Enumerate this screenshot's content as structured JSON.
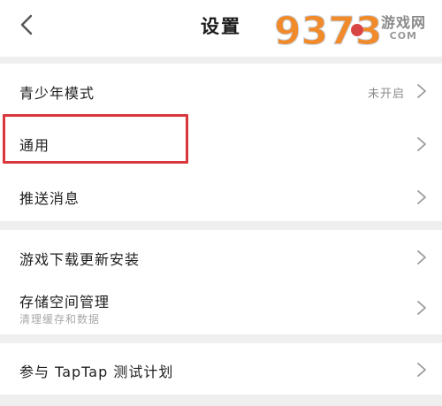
{
  "header": {
    "title": "设置",
    "watermark_text": "游戏网",
    "watermark_sub": "COM",
    "watermark_number": "9373"
  },
  "groups": [
    {
      "items": [
        {
          "label": "青少年模式",
          "value": "未开启"
        },
        {
          "label": "通用"
        },
        {
          "label": "推送消息"
        }
      ]
    },
    {
      "items": [
        {
          "label": "游戏下载更新安装"
        },
        {
          "label": "存储空间管理",
          "sublabel": "清理缓存和数据"
        }
      ]
    },
    {
      "items": [
        {
          "label": "参与 TapTap 测试计划"
        }
      ]
    }
  ],
  "colors": {
    "highlight": "#d9363e",
    "background": "#efefef",
    "chevron": "#9a9a9a"
  },
  "icons": {
    "back": "chevron-left-icon",
    "row_arrow": "chevron-right-icon"
  }
}
